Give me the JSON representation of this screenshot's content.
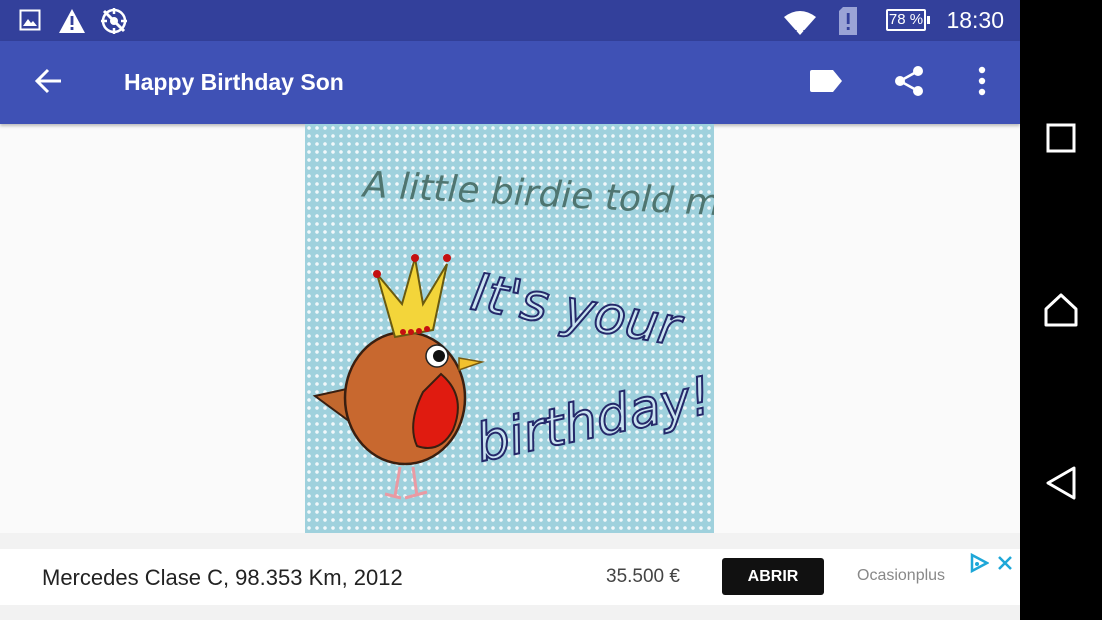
{
  "status_bar": {
    "time": "18:30",
    "battery_level": "78 %",
    "icons": [
      "image-icon",
      "warning-icon",
      "no-location-icon",
      "wifi-icon",
      "sim-alert-icon",
      "battery-icon"
    ],
    "background": "#33409b"
  },
  "app_bar": {
    "title": "Happy Birthday Son",
    "actions": [
      "arrow-back-icon",
      "label-icon",
      "share-icon",
      "more-vert-icon"
    ],
    "background": "#3f51b5"
  },
  "card": {
    "line1": "A little birdie told me...",
    "line2": "It's your",
    "line3": "birthday!",
    "background": "#9fd1dd"
  },
  "ad": {
    "title": "Mercedes Clase C, 98.353 Km, 2012",
    "price": "35.500 €",
    "cta_label": "ABRIR",
    "brand": "Ocasionplus",
    "icons": [
      "adchoices-icon",
      "close-icon"
    ]
  },
  "nav_bar": {
    "buttons": [
      "recent-apps-icon",
      "home-icon",
      "back-icon"
    ]
  }
}
